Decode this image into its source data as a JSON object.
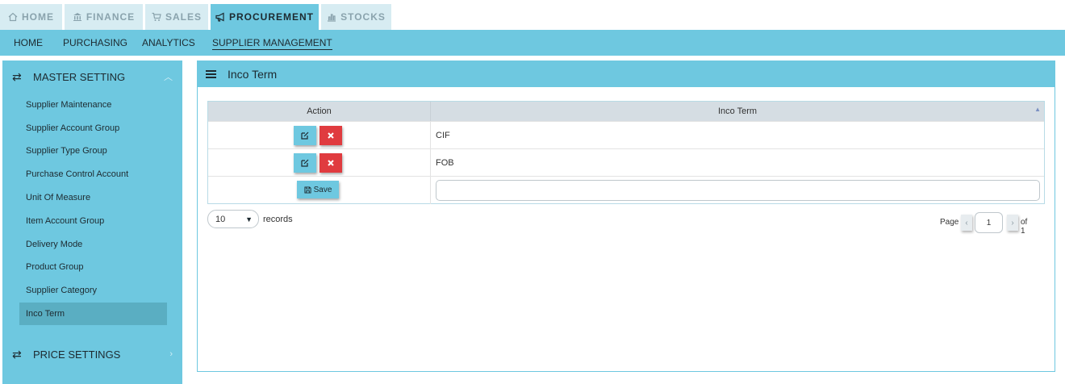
{
  "top_tabs": [
    {
      "label": "HOME",
      "icon": "home-icon"
    },
    {
      "label": "FINANCE",
      "icon": "bank-icon"
    },
    {
      "label": "SALES",
      "icon": "cart-icon"
    },
    {
      "label": "PROCUREMENT",
      "icon": "bullhorn-icon"
    },
    {
      "label": "STOCKS",
      "icon": "bar-chart-icon"
    }
  ],
  "active_top_tab": "PROCUREMENT",
  "sub_nav": [
    "HOME",
    "PURCHASING",
    "ANALYTICS",
    "SUPPLIER MANAGEMENT"
  ],
  "active_sub_nav": "SUPPLIER MANAGEMENT",
  "sidebar": {
    "sections": [
      {
        "label": "MASTER SETTING",
        "expanded": true
      },
      {
        "label": "PRICE SETTINGS",
        "expanded": false
      }
    ],
    "items": [
      "Supplier Maintenance",
      "Supplier Account Group",
      "Supplier Type Group",
      "Purchase Control Account",
      "Unit Of Measure",
      "Item Account Group",
      "Delivery Mode",
      "Product Group",
      "Supplier Category",
      "Inco Term"
    ],
    "active_item": "Inco Term"
  },
  "panel": {
    "title": "Inco Term",
    "columns": {
      "action": "Action",
      "inco_term": "Inco Term"
    },
    "rows": [
      "CIF",
      "FOB"
    ],
    "save_label": "Save",
    "new_value": ""
  },
  "records": {
    "selected": "10",
    "label": "records"
  },
  "pager": {
    "page_label": "Page",
    "current": "1",
    "of_label": "of 1"
  },
  "colors": {
    "accent": "#6ec8e0",
    "delete": "#e03b3f",
    "active_item": "#5aaec2"
  }
}
